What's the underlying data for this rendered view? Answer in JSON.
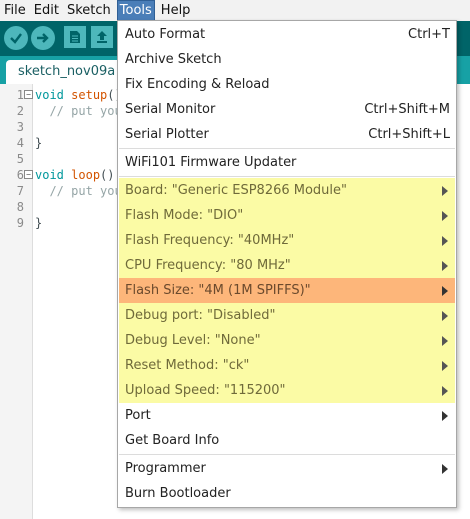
{
  "menubar": {
    "items": [
      "File",
      "Edit",
      "Sketch",
      "Tools",
      "Help"
    ],
    "active_index": 3
  },
  "toolbar": {
    "buttons": [
      "verify-icon",
      "upload-icon",
      "new-icon",
      "open-icon",
      "save-icon",
      "serial-monitor-icon"
    ]
  },
  "tab": {
    "label": "sketch_nov09a"
  },
  "editor": {
    "line_numbers": [
      "1",
      "2",
      "3",
      "4",
      "5",
      "6",
      "7",
      "8",
      "9"
    ],
    "lines": [
      {
        "kw": "void",
        "fn": "setup",
        "rest": "() {"
      },
      {
        "comment": "  // put your setup code here, to run once:"
      },
      {
        "text": ""
      },
      {
        "text": "}"
      },
      {
        "text": ""
      },
      {
        "kw": "void",
        "fn": "loop",
        "rest": "() {"
      },
      {
        "comment": "  // put your main code here, to run repeatedly:"
      },
      {
        "text": ""
      },
      {
        "text": "}"
      }
    ]
  },
  "tools_menu": {
    "auto_format": "Auto Format",
    "auto_format_shortcut": "Ctrl+T",
    "archive_sketch": "Archive Sketch",
    "fix_encoding": "Fix Encoding & Reload",
    "serial_monitor": "Serial Monitor",
    "serial_monitor_shortcut": "Ctrl+Shift+M",
    "serial_plotter": "Serial Plotter",
    "serial_plotter_shortcut": "Ctrl+Shift+L",
    "wifi_updater": "WiFi101 Firmware Updater",
    "board": "Board: \"Generic ESP8266 Module\"",
    "flash_mode": "Flash Mode: \"DIO\"",
    "flash_frequency": "Flash Frequency: \"40MHz\"",
    "cpu_frequency": "CPU Frequency: \"80 MHz\"",
    "flash_size": "Flash Size: \"4M (1M SPIFFS)\"",
    "debug_port": "Debug port: \"Disabled\"",
    "debug_level": "Debug Level: \"None\"",
    "reset_method": "Reset Method: \"ck\"",
    "upload_speed": "Upload Speed: \"115200\"",
    "port": "Port",
    "get_board_info": "Get Board Info",
    "programmer": "Programmer",
    "burn_bootloader": "Burn Bootloader"
  },
  "colors": {
    "toolbar_bg": "#006468",
    "tab_strip_bg": "#17a1a5",
    "board_option_bg": "#fbfba5",
    "highlight_bg": "#fdb67a",
    "menu_active_bg": "#4a7eb8"
  }
}
